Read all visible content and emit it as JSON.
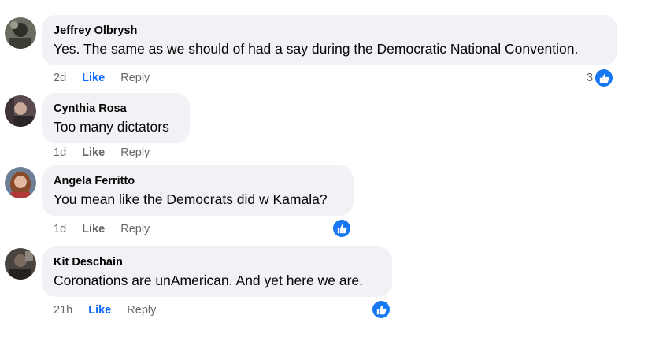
{
  "comments": [
    {
      "author": "Jeffrey Olbrysh",
      "text": "Yes. The same as we should of had a say during the Democratic National Convention.",
      "time": "2d",
      "like": "Like",
      "reply": "Reply",
      "like_active": true,
      "reaction_count": "3"
    },
    {
      "author": "Cynthia Rosa",
      "text": "Too many dictators",
      "time": "1d",
      "like": "Like",
      "reply": "Reply",
      "like_active": false
    },
    {
      "author": "Angela Ferritto",
      "text": "You mean like the Democrats did w Kamala?",
      "time": "1d",
      "like": "Like",
      "reply": "Reply",
      "like_active": false
    },
    {
      "author": "Kit Deschain",
      "text": "Coronations are unAmerican. And yet here we are.",
      "time": "21h",
      "like": "Like",
      "reply": "Reply",
      "like_active": true
    }
  ],
  "icons": {
    "reaction": "thumbs-up-icon"
  },
  "colors": {
    "accent": "#0866ff",
    "reaction": "#1877f2",
    "bubble": "#f0f2f5"
  }
}
